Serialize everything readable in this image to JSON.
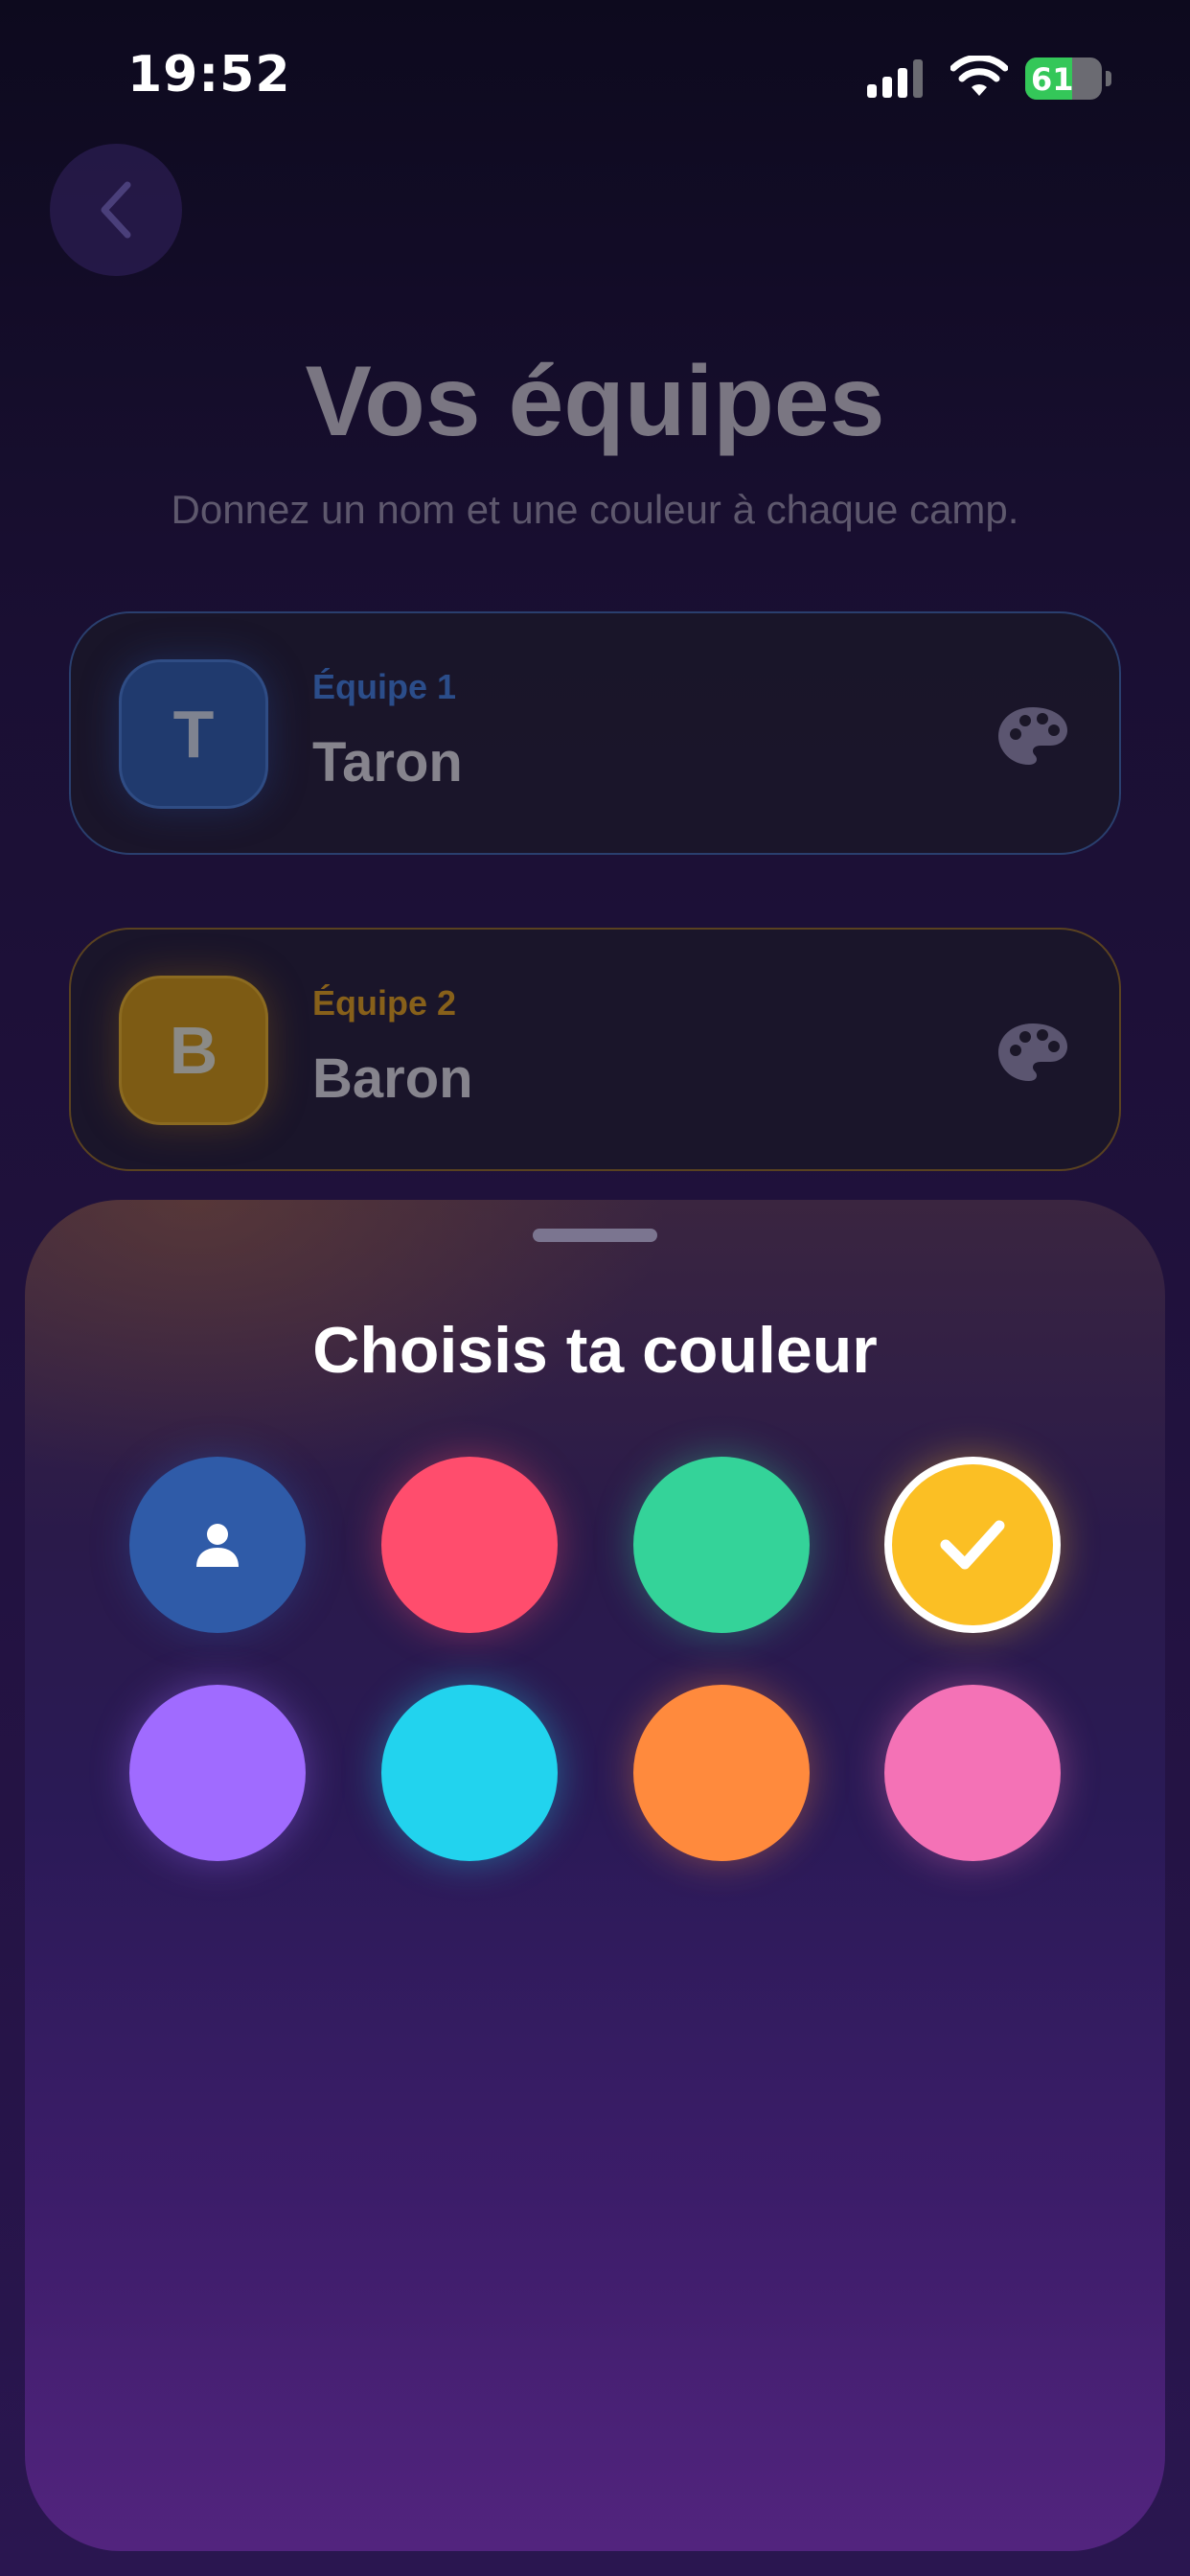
{
  "status_bar": {
    "time": "19:52",
    "battery_level": "61",
    "icons": [
      "signal-icon",
      "wifi-icon",
      "battery-icon"
    ]
  },
  "header": {
    "title": "Vos équipes",
    "subtitle": "Donnez un nom et une couleur à chaque camp."
  },
  "teams": [
    {
      "label": "Équipe 1",
      "name": "Taron",
      "initial": "T",
      "color": "#3b6ab8",
      "icon": "palette-icon"
    },
    {
      "label": "Équipe 2",
      "name": "Baron",
      "initial": "B",
      "color": "#f5a623",
      "icon": "palette-icon"
    }
  ],
  "color_sheet": {
    "title": "Choisis ta couleur",
    "swatches": [
      {
        "color": "#2f5ba8",
        "state": "taken-by-other-team",
        "icon": "person-icon"
      },
      {
        "color": "#ff4d6d",
        "state": "available"
      },
      {
        "color": "#34d399",
        "state": "available"
      },
      {
        "color": "#fbbf24",
        "state": "selected",
        "icon": "checkmark-icon"
      },
      {
        "color": "#a06bff",
        "state": "available"
      },
      {
        "color": "#22d3ee",
        "state": "available"
      },
      {
        "color": "#ff8a3d",
        "state": "available"
      },
      {
        "color": "#f472b6",
        "state": "available"
      }
    ]
  }
}
